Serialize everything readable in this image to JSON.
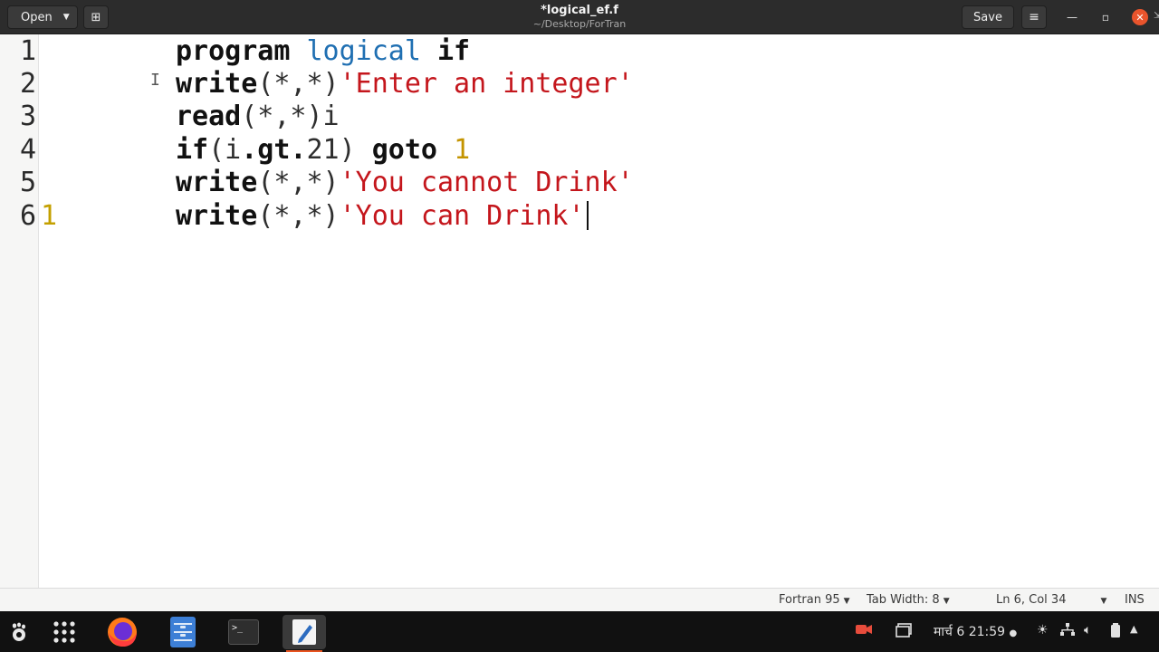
{
  "window": {
    "title": "*logical_ef.f",
    "subtitle": "~/Desktop/ForTran"
  },
  "header": {
    "open_label": "Open",
    "open_caret": "▼",
    "newdoc_glyph": "⊞",
    "save_label": "Save",
    "menu_glyph": "≡",
    "minimize_glyph": "—",
    "maximize_glyph": "▫",
    "close_glyph": "✕"
  },
  "editor": {
    "line_numbers": [
      "1",
      "2",
      "3",
      "4",
      "5",
      "6"
    ],
    "line6_label": "1",
    "lines": {
      "l1": {
        "kw1": "program",
        "ident": "logical",
        "kw2": "if"
      },
      "l2": {
        "kw": "write",
        "args": "(*,*)",
        "str": "'Enter an integer'"
      },
      "l3": {
        "kw": "read",
        "rest": "(*,*)i"
      },
      "l4": {
        "kw_if": "if",
        "p1": "(i",
        "op": ".gt.",
        "p2": "21)",
        "kw_goto": "goto",
        "num": "1"
      },
      "l5": {
        "kw": "write",
        "args": "(*,*)",
        "str": "'You cannot Drink'"
      },
      "l6": {
        "kw": "write",
        "args": "(*,*)",
        "str": "'You can Drink'"
      }
    }
  },
  "statusbar": {
    "language": "Fortran 95",
    "tab_width": "Tab Width: 8",
    "position": "Ln 6, Col 34",
    "mode": "INS",
    "dropdown_caret": "▼"
  },
  "taskbar": {
    "apps": [
      "gnome-activities-icon",
      "show-applications-icon",
      "firefox-icon",
      "files-icon",
      "terminal-icon",
      "text-editor-icon"
    ],
    "terminal_glyph": ">_",
    "datetime": "मार्च 6  21:59",
    "recording_dot": "●"
  },
  "colors": {
    "header_bg": "#2c2c2c",
    "close_button": "#e9542c",
    "keyword": "#111111",
    "identifier": "#1f6fb2",
    "string": "#c4161c",
    "number": "#c49400",
    "taskbar_bg": "#111111",
    "active_indicator": "#e95420"
  }
}
